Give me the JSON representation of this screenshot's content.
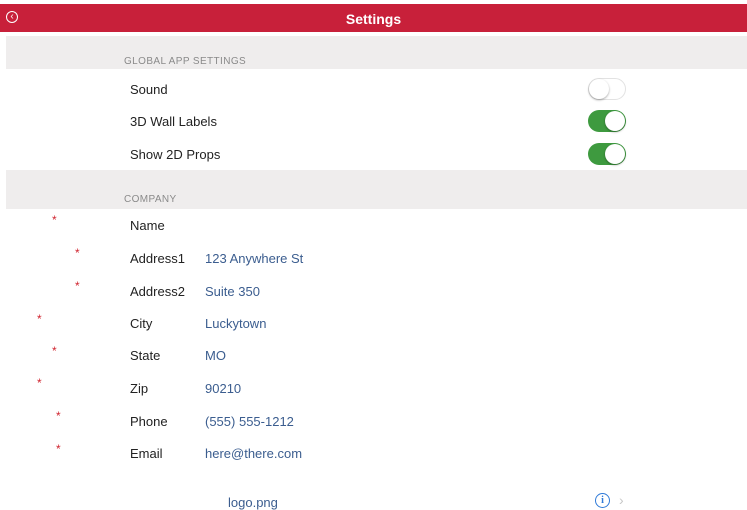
{
  "header": {
    "title": "Settings",
    "back_icon": "back-arrow-circle-icon",
    "color": "#c8203a"
  },
  "global": {
    "section_label": "GLOBAL APP SETTINGS",
    "toggles": [
      {
        "label": "Sound",
        "on": false
      },
      {
        "label": "3D Wall Labels",
        "on": true
      },
      {
        "label": "Show 2D Props",
        "on": true
      }
    ]
  },
  "company": {
    "section_label": "COMPANY",
    "fields": [
      {
        "label": "Name",
        "value": ""
      },
      {
        "label": "Address1",
        "value": "123 Anywhere St"
      },
      {
        "label": "Address2",
        "value": "Suite 350"
      },
      {
        "label": "City",
        "value": "Luckytown"
      },
      {
        "label": "State",
        "value": "MO"
      },
      {
        "label": "Zip",
        "value": "90210"
      },
      {
        "label": "Phone",
        "value": "(555) 555-1212"
      },
      {
        "label": "Email",
        "value": "here@there.com"
      }
    ],
    "required_marker": "*",
    "logo_label": "logo.png"
  },
  "colors": {
    "toggle_on": "#3e9a3f",
    "value_text": "#3b5d8f",
    "required": "#d02530"
  }
}
